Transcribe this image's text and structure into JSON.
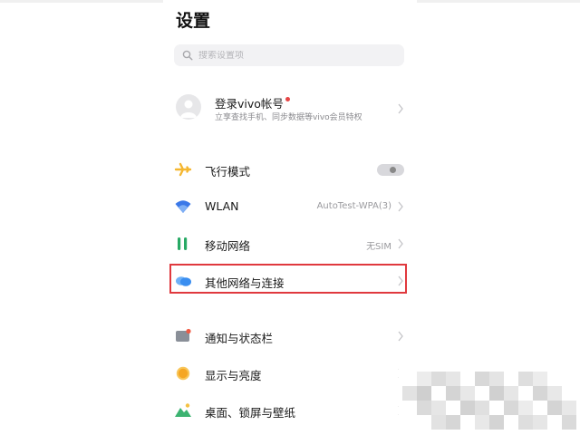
{
  "header": {
    "title": "设置"
  },
  "search": {
    "placeholder": "搜索设置项"
  },
  "account": {
    "name": "登录vivo帐号",
    "subtitle": "立享查找手机、同步数据等vivo会员特权"
  },
  "settings": [
    {
      "id": "airplane",
      "label": "飞行模式",
      "icon": "airplane-icon",
      "toggle": "off"
    },
    {
      "id": "wlan",
      "label": "WLAN",
      "value": "AutoTest-WPA(3)",
      "icon": "wifi-icon"
    },
    {
      "id": "mobile",
      "label": "移动网络",
      "value": "无SIM",
      "icon": "mobile-network-icon"
    },
    {
      "id": "other-network",
      "label": "其他网络与连接",
      "icon": "connection-icon",
      "highlighted": true
    },
    {
      "id": "notifications",
      "label": "通知与状态栏",
      "icon": "notification-icon"
    },
    {
      "id": "display",
      "label": "显示与亮度",
      "icon": "brightness-icon"
    },
    {
      "id": "wallpaper",
      "label": "桌面、锁屏与壁纸",
      "icon": "wallpaper-icon"
    }
  ],
  "colors": {
    "highlight": "#e0393e",
    "airplane": "#f5b731",
    "wlan": "#3a78e8",
    "mobile": "#27a964",
    "connection": "#3a8ef0",
    "display": "#f5a623",
    "wallpaper": "#3cb371"
  }
}
